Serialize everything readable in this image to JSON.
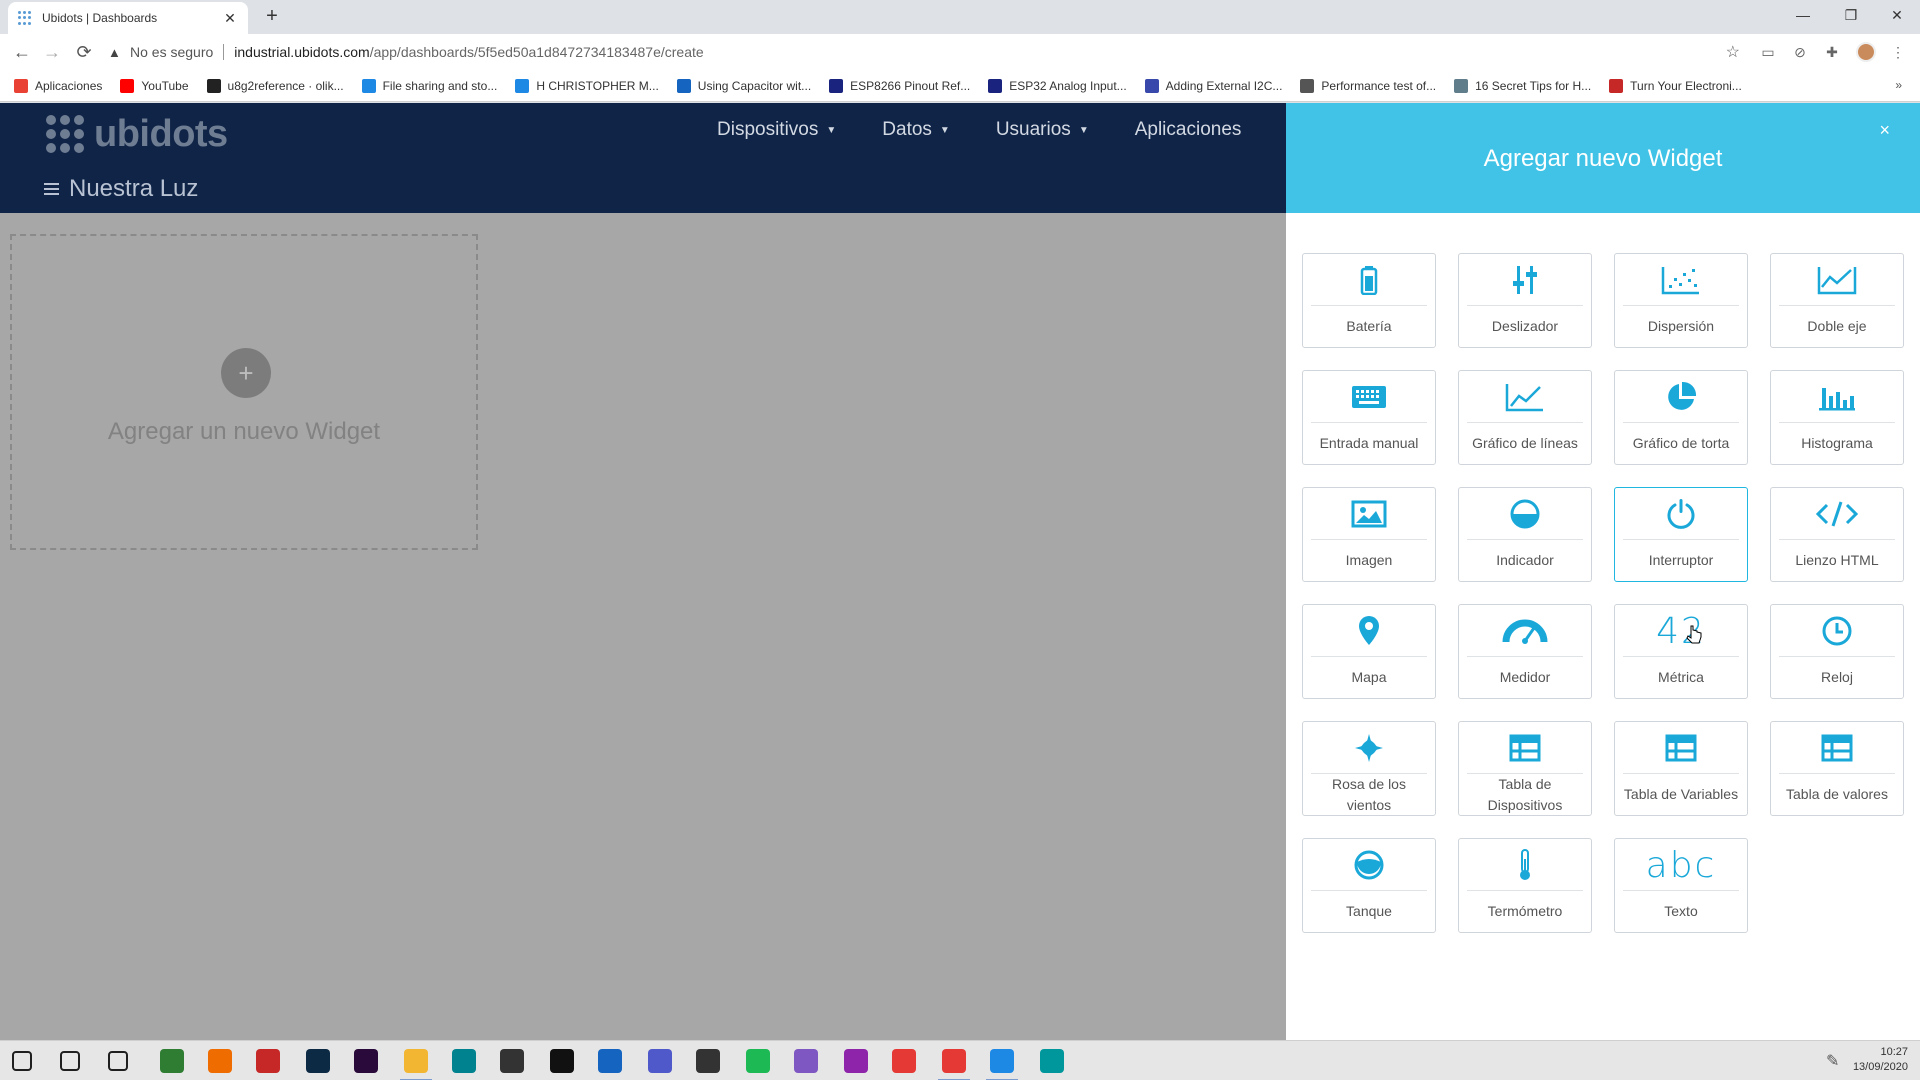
{
  "browser": {
    "tab_title": "Ubidots | Dashboards",
    "tab_close": "✕",
    "new_tab": "+",
    "security_label": "No es seguro",
    "url_host": "industrial.ubidots.com",
    "url_path": "/app/dashboards/5f5ed50a1d8472734183487e/create",
    "window": {
      "minimize": "—",
      "maximize": "❐",
      "close": "✕"
    },
    "bookmarks": [
      {
        "label": "Aplicaciones",
        "color": "#e94235"
      },
      {
        "label": "YouTube",
        "color": "#ff0000"
      },
      {
        "label": "u8g2reference · olik...",
        "color": "#222222"
      },
      {
        "label": "File sharing and sto...",
        "color": "#1e88e5"
      },
      {
        "label": "H CHRISTOPHER M...",
        "color": "#1e88e5"
      },
      {
        "label": "Using Capacitor wit...",
        "color": "#1565c0"
      },
      {
        "label": "ESP8266 Pinout Ref...",
        "color": "#1a237e"
      },
      {
        "label": "ESP32 Analog Input...",
        "color": "#1a237e"
      },
      {
        "label": "Adding External I2C...",
        "color": "#3949ab"
      },
      {
        "label": "Performance test of...",
        "color": "#555555"
      },
      {
        "label": "16 Secret Tips for H...",
        "color": "#607d8b"
      },
      {
        "label": "Turn Your Electroni...",
        "color": "#c62828"
      }
    ],
    "bookmarks_more": "»"
  },
  "app": {
    "logo": "ubidots",
    "nav": [
      {
        "label": "Dispositivos",
        "has_caret": true
      },
      {
        "label": "Datos",
        "has_caret": true
      },
      {
        "label": "Usuarios",
        "has_caret": true
      },
      {
        "label": "Aplicaciones",
        "has_caret": false
      }
    ],
    "dashboard_title": "Nuestra Luz",
    "add_widget_plus": "+",
    "add_widget_label": "Agregar un nuevo Widget"
  },
  "panel": {
    "title": "Agregar nuevo Widget",
    "close": "×",
    "accent_color": "#40c3e6",
    "icon_color": "#1aa8d9",
    "widgets": [
      {
        "label": "Batería",
        "icon": "battery-icon"
      },
      {
        "label": "Deslizador",
        "icon": "slider-icon"
      },
      {
        "label": "Dispersión",
        "icon": "scatter-icon"
      },
      {
        "label": "Doble eje",
        "icon": "double-axis-icon"
      },
      {
        "label": "Entrada manual",
        "icon": "keyboard-icon"
      },
      {
        "label": "Gráfico de líneas",
        "icon": "line-chart-icon"
      },
      {
        "label": "Gráfico de torta",
        "icon": "pie-chart-icon"
      },
      {
        "label": "Histograma",
        "icon": "histogram-icon"
      },
      {
        "label": "Imagen",
        "icon": "image-icon"
      },
      {
        "label": "Indicador",
        "icon": "indicator-icon"
      },
      {
        "label": "Interruptor",
        "icon": "power-icon",
        "active": true
      },
      {
        "label": "Lienzo HTML",
        "icon": "code-icon"
      },
      {
        "label": "Mapa",
        "icon": "map-pin-icon"
      },
      {
        "label": "Medidor",
        "icon": "gauge-icon"
      },
      {
        "label": "Métrica",
        "icon": "metric-icon",
        "glyph": "42"
      },
      {
        "label": "Reloj",
        "icon": "clock-icon"
      },
      {
        "label": "Rosa de los vientos",
        "icon": "wind-rose-icon"
      },
      {
        "label": "Tabla de Dispositivos",
        "icon": "table-icon"
      },
      {
        "label": "Tabla de Variables",
        "icon": "table-icon"
      },
      {
        "label": "Tabla de valores",
        "icon": "table-icon"
      },
      {
        "label": "Tanque",
        "icon": "tank-icon"
      },
      {
        "label": "Termómetro",
        "icon": "thermometer-icon"
      },
      {
        "label": "Texto",
        "icon": "text-icon",
        "glyph": "abc"
      }
    ]
  },
  "taskbar": {
    "time": "10:27",
    "date": "13/09/2020"
  }
}
